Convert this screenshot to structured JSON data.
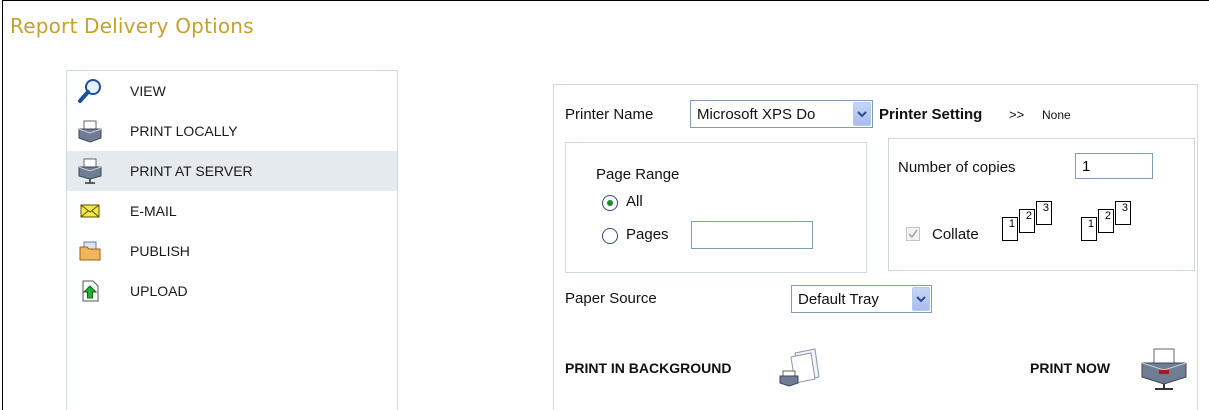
{
  "title": "Report Delivery Options",
  "menu": {
    "items": [
      {
        "label": "VIEW",
        "icon": "magnifier-icon"
      },
      {
        "label": "PRINT LOCALLY",
        "icon": "printer-icon"
      },
      {
        "label": "PRINT AT SERVER",
        "icon": "network-printer-icon"
      },
      {
        "label": "E-MAIL",
        "icon": "envelope-icon"
      },
      {
        "label": "PUBLISH",
        "icon": "folder-icon"
      },
      {
        "label": "UPLOAD",
        "icon": "upload-icon"
      }
    ],
    "active_index": 2
  },
  "form": {
    "printer_name_label": "Printer Name",
    "printer_name_value": "Microsoft XPS Do",
    "printer_setting_label": "Printer Setting",
    "printer_setting_arrow": ">>",
    "printer_setting_value": "None",
    "page_range_label": "Page Range",
    "range_all_label": "All",
    "range_pages_label": "Pages",
    "range_pages_value": "",
    "range_selected": "All",
    "copies_label": "Number of copies",
    "copies_value": "1",
    "collate_label": "Collate",
    "collate_checked": true,
    "collate_pages": [
      "1",
      "2",
      "3"
    ],
    "paper_source_label": "Paper Source",
    "paper_source_value": "Default Tray",
    "print_background_label": "PRINT IN BACKGROUND",
    "print_now_label": "PRINT NOW"
  },
  "colors": {
    "title": "#c8a02a",
    "active_menu_bg": "#e4eaee",
    "border": "#cfd8de"
  }
}
